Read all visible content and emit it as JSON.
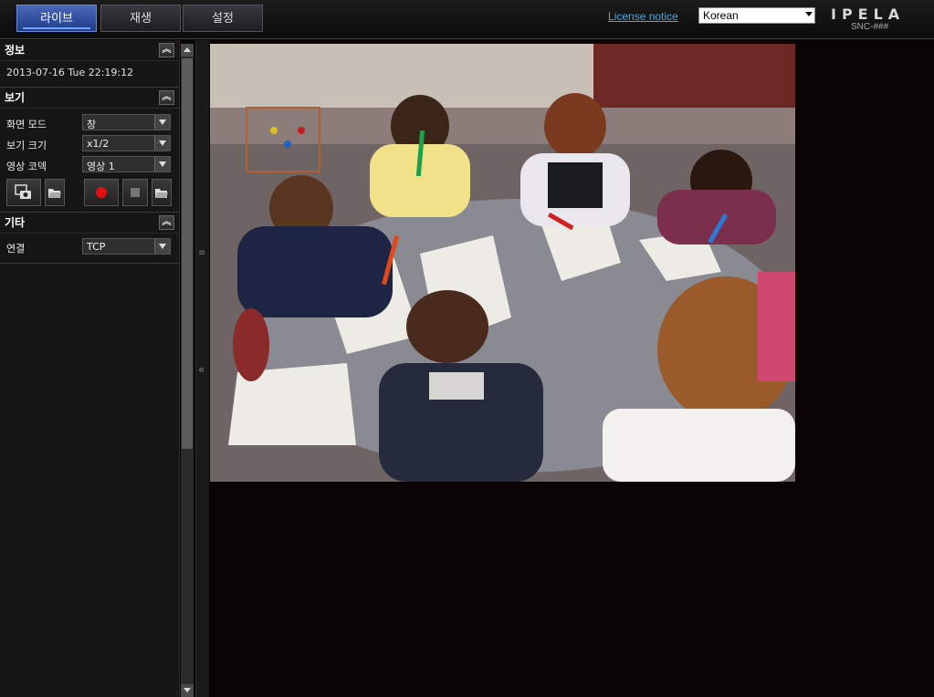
{
  "tabs": [
    {
      "label": "라이브",
      "active": true
    },
    {
      "label": "재생",
      "active": false
    },
    {
      "label": "설정",
      "active": false
    }
  ],
  "header": {
    "license_link": "License notice",
    "language": {
      "selected": "Korean"
    },
    "brand": "IPELA",
    "model": "SNC-###"
  },
  "sidebar": {
    "info": {
      "title": "정보",
      "datetime": "2013-07-16 Tue 22:19:12"
    },
    "view": {
      "title": "보기",
      "rows": [
        {
          "label": "화면 모드",
          "value": "창"
        },
        {
          "label": "보기 크기",
          "value": "x1/2"
        },
        {
          "label": "영상 코덱",
          "value": "영상 1"
        }
      ]
    },
    "other": {
      "title": "기타",
      "rows": [
        {
          "label": "연결",
          "value": "TCP"
        }
      ]
    }
  },
  "colors": {
    "active_tab": "#2b4a9c",
    "link": "#4fa8dc",
    "record": "#e01010"
  },
  "icons": [
    "camera-capture-icon",
    "folder-open-icon",
    "record-icon",
    "stop-icon",
    "folder-open-icon",
    "collapse-up-icon",
    "collapse-left-icon"
  ]
}
